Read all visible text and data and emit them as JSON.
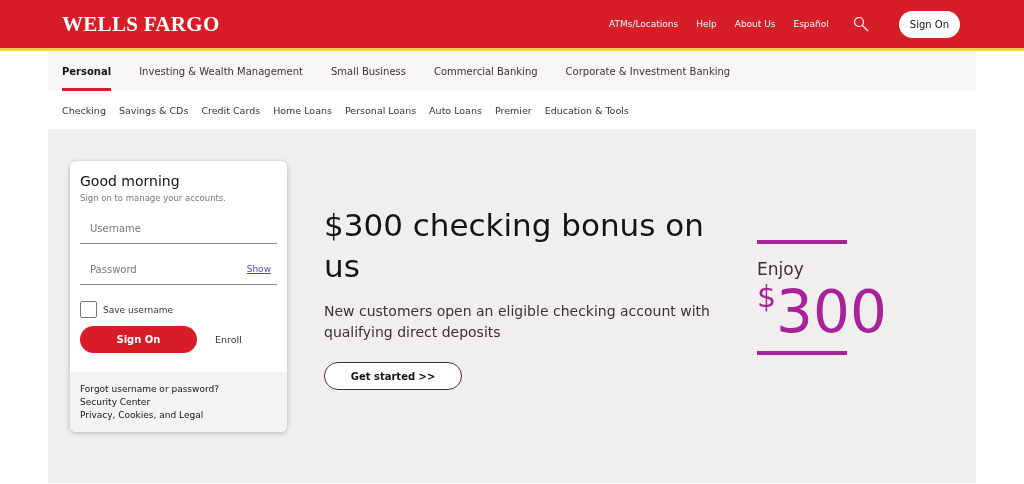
{
  "header": {
    "logo": "WELLS FARGO",
    "links": [
      "ATMs/Locations",
      "Help",
      "About Us",
      "Español"
    ],
    "sign_on": "Sign On"
  },
  "primary_nav": [
    {
      "label": "Personal",
      "selected": true
    },
    {
      "label": "Investing & Wealth Management",
      "selected": false
    },
    {
      "label": "Small Business",
      "selected": false
    },
    {
      "label": "Commercial Banking",
      "selected": false
    },
    {
      "label": "Corporate & Investment Banking",
      "selected": false
    }
  ],
  "secondary_nav": [
    "Checking",
    "Savings & CDs",
    "Credit Cards",
    "Home Loans",
    "Personal Loans",
    "Auto Loans",
    "Premier",
    "Education & Tools"
  ],
  "sign_on_card": {
    "greeting": "Good morning",
    "subtitle": "Sign on to manage your accounts.",
    "username": {
      "placeholder": "Username"
    },
    "password": {
      "placeholder": "Password"
    },
    "show": "Show",
    "save_username": {
      "label": "Save username",
      "checked": false
    },
    "sign_on": "Sign On",
    "enroll": "Enroll",
    "links": [
      "Forgot username or password?",
      "Security Center",
      "Privacy, Cookies, and Legal"
    ]
  },
  "promo": {
    "headline": "$300 checking bonus on us",
    "text": "New customers open an eligible checking account with qualifying direct deposits",
    "button": "Get started >>",
    "enjoy": "Enjoy",
    "currency": "$",
    "amount": "300"
  }
}
